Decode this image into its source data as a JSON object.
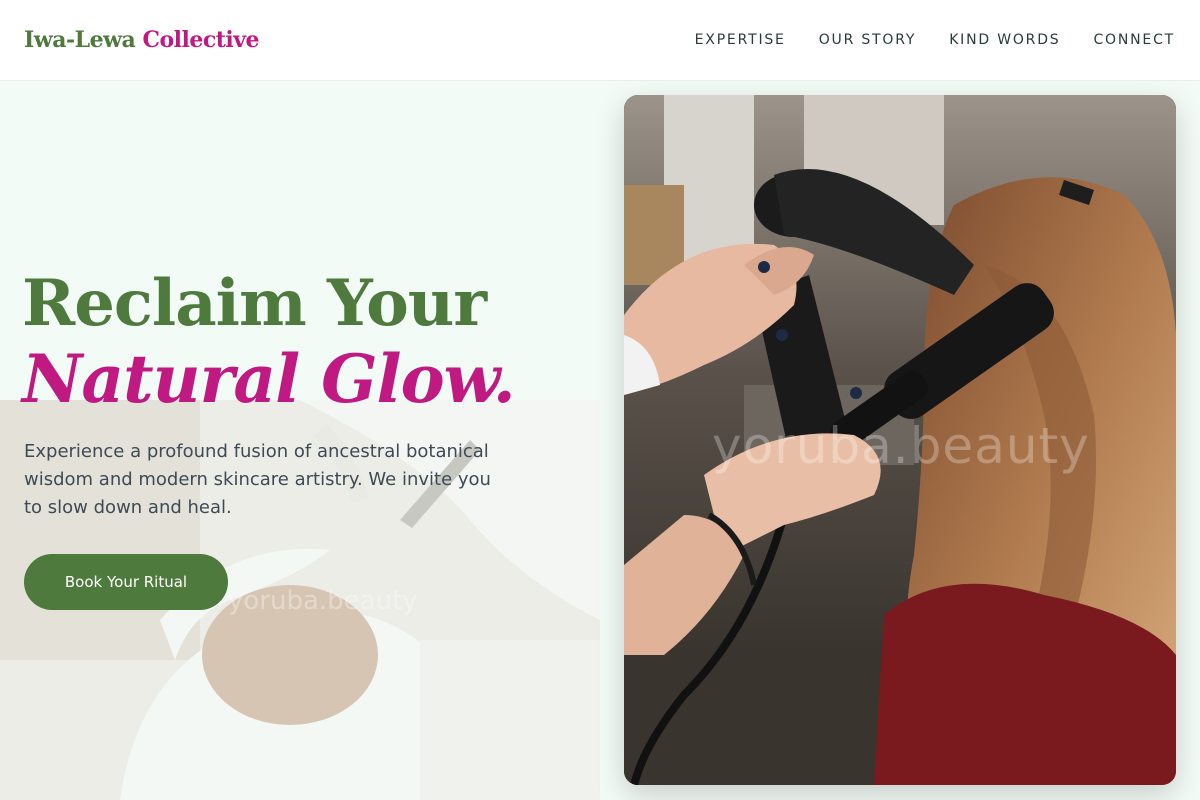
{
  "brand": {
    "part1": "Iwa-Lewa",
    "part2": "Collective"
  },
  "nav": {
    "items": [
      "EXPERTISE",
      "OUR STORY",
      "KIND WORDS",
      "CONNECT"
    ]
  },
  "hero": {
    "headline_line1": "Reclaim Your",
    "headline_line2": "Natural Glow.",
    "subtext": "Experience a profound fusion of ancestral botanical wisdom and modern skincare artistry. We invite you to slow down and heal.",
    "cta_label": "Book Your Ritual",
    "watermark": "yoruba.beauty",
    "watermark_small": "yoruba.beauty"
  },
  "colors": {
    "green": "#4f7a3d",
    "magenta": "#c01a82",
    "background": "#f3fbf7"
  }
}
